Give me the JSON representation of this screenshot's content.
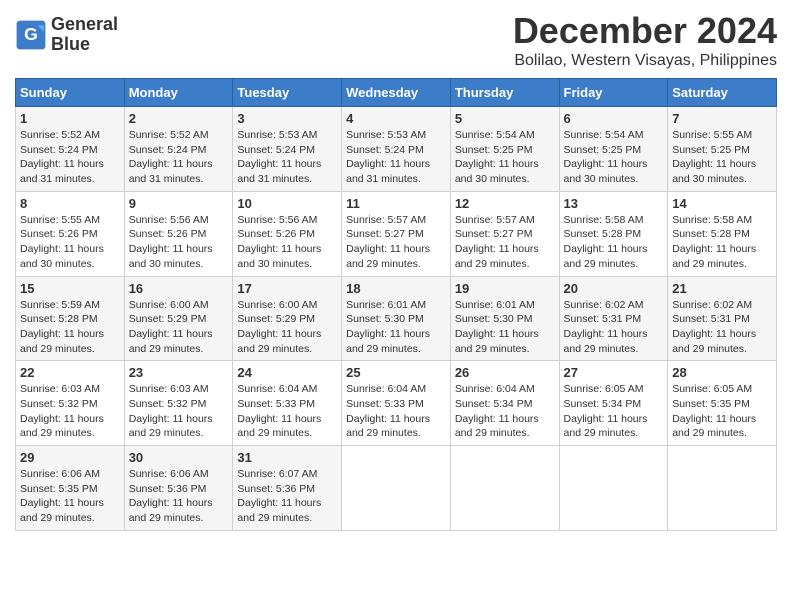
{
  "logo": {
    "line1": "General",
    "line2": "Blue"
  },
  "title": "December 2024",
  "subtitle": "Bolilao, Western Visayas, Philippines",
  "days_of_week": [
    "Sunday",
    "Monday",
    "Tuesday",
    "Wednesday",
    "Thursday",
    "Friday",
    "Saturday"
  ],
  "weeks": [
    [
      {
        "day": "1",
        "sunrise": "5:52 AM",
        "sunset": "5:24 PM",
        "daylight": "11 hours and 31 minutes."
      },
      {
        "day": "2",
        "sunrise": "5:52 AM",
        "sunset": "5:24 PM",
        "daylight": "11 hours and 31 minutes."
      },
      {
        "day": "3",
        "sunrise": "5:53 AM",
        "sunset": "5:24 PM",
        "daylight": "11 hours and 31 minutes."
      },
      {
        "day": "4",
        "sunrise": "5:53 AM",
        "sunset": "5:24 PM",
        "daylight": "11 hours and 31 minutes."
      },
      {
        "day": "5",
        "sunrise": "5:54 AM",
        "sunset": "5:25 PM",
        "daylight": "11 hours and 30 minutes."
      },
      {
        "day": "6",
        "sunrise": "5:54 AM",
        "sunset": "5:25 PM",
        "daylight": "11 hours and 30 minutes."
      },
      {
        "day": "7",
        "sunrise": "5:55 AM",
        "sunset": "5:25 PM",
        "daylight": "11 hours and 30 minutes."
      }
    ],
    [
      {
        "day": "8",
        "sunrise": "5:55 AM",
        "sunset": "5:26 PM",
        "daylight": "11 hours and 30 minutes."
      },
      {
        "day": "9",
        "sunrise": "5:56 AM",
        "sunset": "5:26 PM",
        "daylight": "11 hours and 30 minutes."
      },
      {
        "day": "10",
        "sunrise": "5:56 AM",
        "sunset": "5:26 PM",
        "daylight": "11 hours and 30 minutes."
      },
      {
        "day": "11",
        "sunrise": "5:57 AM",
        "sunset": "5:27 PM",
        "daylight": "11 hours and 29 minutes."
      },
      {
        "day": "12",
        "sunrise": "5:57 AM",
        "sunset": "5:27 PM",
        "daylight": "11 hours and 29 minutes."
      },
      {
        "day": "13",
        "sunrise": "5:58 AM",
        "sunset": "5:28 PM",
        "daylight": "11 hours and 29 minutes."
      },
      {
        "day": "14",
        "sunrise": "5:58 AM",
        "sunset": "5:28 PM",
        "daylight": "11 hours and 29 minutes."
      }
    ],
    [
      {
        "day": "15",
        "sunrise": "5:59 AM",
        "sunset": "5:28 PM",
        "daylight": "11 hours and 29 minutes."
      },
      {
        "day": "16",
        "sunrise": "6:00 AM",
        "sunset": "5:29 PM",
        "daylight": "11 hours and 29 minutes."
      },
      {
        "day": "17",
        "sunrise": "6:00 AM",
        "sunset": "5:29 PM",
        "daylight": "11 hours and 29 minutes."
      },
      {
        "day": "18",
        "sunrise": "6:01 AM",
        "sunset": "5:30 PM",
        "daylight": "11 hours and 29 minutes."
      },
      {
        "day": "19",
        "sunrise": "6:01 AM",
        "sunset": "5:30 PM",
        "daylight": "11 hours and 29 minutes."
      },
      {
        "day": "20",
        "sunrise": "6:02 AM",
        "sunset": "5:31 PM",
        "daylight": "11 hours and 29 minutes."
      },
      {
        "day": "21",
        "sunrise": "6:02 AM",
        "sunset": "5:31 PM",
        "daylight": "11 hours and 29 minutes."
      }
    ],
    [
      {
        "day": "22",
        "sunrise": "6:03 AM",
        "sunset": "5:32 PM",
        "daylight": "11 hours and 29 minutes."
      },
      {
        "day": "23",
        "sunrise": "6:03 AM",
        "sunset": "5:32 PM",
        "daylight": "11 hours and 29 minutes."
      },
      {
        "day": "24",
        "sunrise": "6:04 AM",
        "sunset": "5:33 PM",
        "daylight": "11 hours and 29 minutes."
      },
      {
        "day": "25",
        "sunrise": "6:04 AM",
        "sunset": "5:33 PM",
        "daylight": "11 hours and 29 minutes."
      },
      {
        "day": "26",
        "sunrise": "6:04 AM",
        "sunset": "5:34 PM",
        "daylight": "11 hours and 29 minutes."
      },
      {
        "day": "27",
        "sunrise": "6:05 AM",
        "sunset": "5:34 PM",
        "daylight": "11 hours and 29 minutes."
      },
      {
        "day": "28",
        "sunrise": "6:05 AM",
        "sunset": "5:35 PM",
        "daylight": "11 hours and 29 minutes."
      }
    ],
    [
      {
        "day": "29",
        "sunrise": "6:06 AM",
        "sunset": "5:35 PM",
        "daylight": "11 hours and 29 minutes."
      },
      {
        "day": "30",
        "sunrise": "6:06 AM",
        "sunset": "5:36 PM",
        "daylight": "11 hours and 29 minutes."
      },
      {
        "day": "31",
        "sunrise": "6:07 AM",
        "sunset": "5:36 PM",
        "daylight": "11 hours and 29 minutes."
      },
      null,
      null,
      null,
      null
    ]
  ],
  "labels": {
    "sunrise": "Sunrise:",
    "sunset": "Sunset:",
    "daylight": "Daylight:"
  }
}
